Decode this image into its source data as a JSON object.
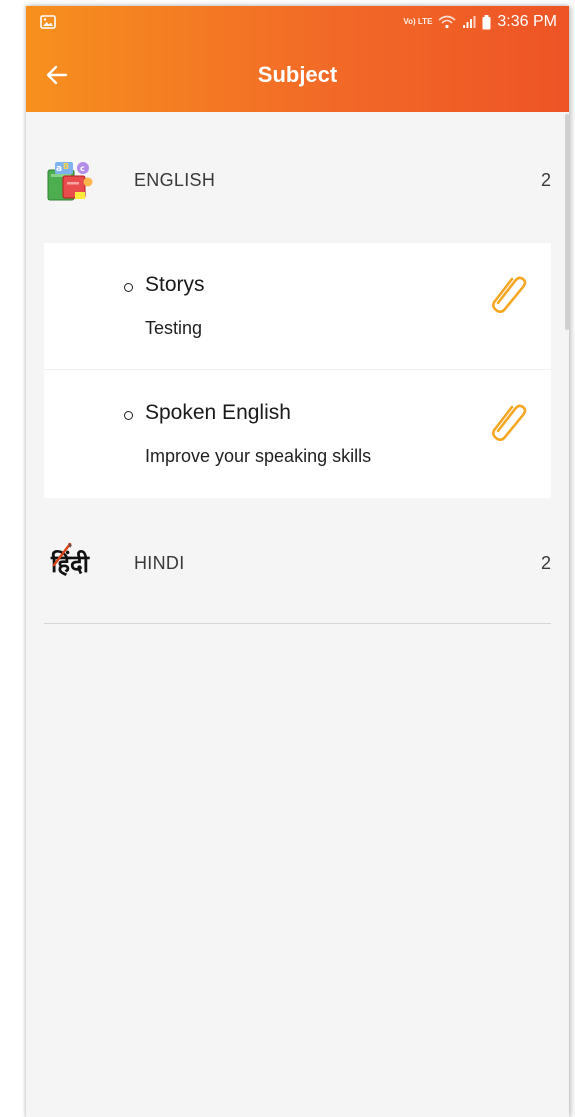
{
  "status_bar": {
    "image_icon": "image-icon",
    "network_label": "Vo) LTE",
    "time": "3:36 PM"
  },
  "app_bar": {
    "back_icon": "back-arrow-icon",
    "title": "Subject"
  },
  "subjects": [
    {
      "name": "ENGLISH",
      "count": "2",
      "icon": "books-icon",
      "expanded": true,
      "topics": [
        {
          "title": "Storys",
          "description": "Testing",
          "icon": "attachment-icon"
        },
        {
          "title": "Spoken English",
          "description": "Improve your speaking skills",
          "icon": "attachment-icon"
        }
      ]
    },
    {
      "name": "HINDI",
      "count": "2",
      "icon_text": "हिंदी",
      "expanded": false
    }
  ],
  "colors": {
    "header_start": "#f7901e",
    "header_end": "#ee5426",
    "attachment": "#f5a623",
    "background": "#f5f5f5"
  }
}
